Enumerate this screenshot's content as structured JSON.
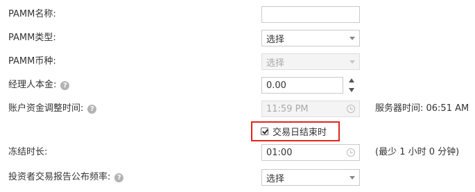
{
  "form": {
    "pamm_name": {
      "label": "PAMM名称:",
      "value": ""
    },
    "pamm_type": {
      "label": "PAMM类型:",
      "value": "选择"
    },
    "pamm_currency": {
      "label": "PAMM币种:",
      "value": "选择",
      "disabled": true
    },
    "manager_capital": {
      "label": "经理人本金:",
      "value": "0.00"
    },
    "balance_adjust_time": {
      "label": "账户资金调整时间:",
      "value": "11:59 PM",
      "disabled": true,
      "server_time": "服务器时间: 06:51 AM"
    },
    "end_of_trading_day": {
      "label": "交易日结束时",
      "checked": true,
      "highlight_color": "#e2231a"
    },
    "freeze_duration": {
      "label": "冻结时长:",
      "value": "01:00",
      "hint": "(最少 1 小时 0 分钟)"
    },
    "report_frequency": {
      "label": "投资者交易报告公布频率:",
      "value": "选择"
    }
  },
  "icons": {
    "help": "question-circle-icon",
    "dropdown": "caret-down-icon",
    "clock": "clock-icon",
    "stepper": "up-down-arrows-icon"
  }
}
